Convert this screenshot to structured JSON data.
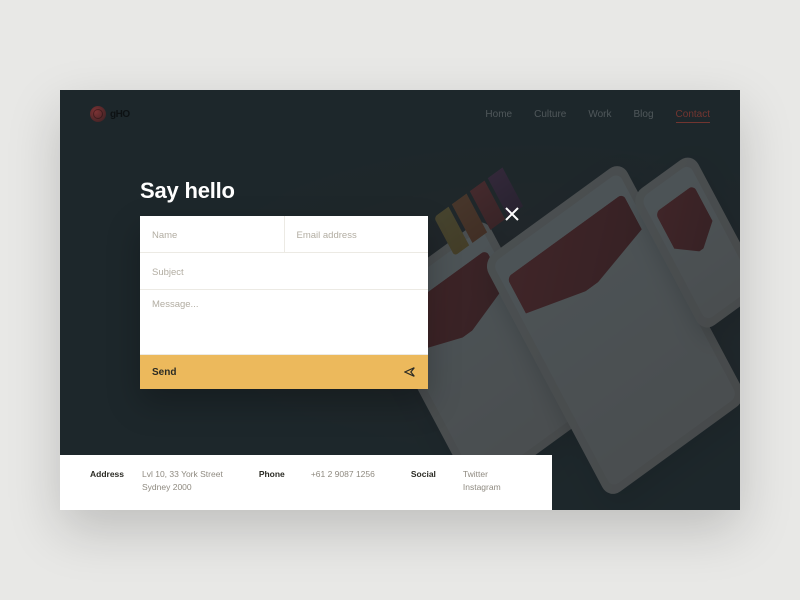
{
  "brand": {
    "name": "gHO"
  },
  "nav": {
    "items": [
      {
        "label": "Home"
      },
      {
        "label": "Culture"
      },
      {
        "label": "Work"
      },
      {
        "label": "Blog"
      },
      {
        "label": "Contact"
      }
    ]
  },
  "heading": "Say hello",
  "form": {
    "name_placeholder": "Name",
    "email_placeholder": "Email address",
    "subject_placeholder": "Subject",
    "message_placeholder": "Message...",
    "send_label": "Send"
  },
  "footer": {
    "address_label": "Address",
    "address_line1": "Lvl 10, 33 York Street",
    "address_line2": "Sydney 2000",
    "phone_label": "Phone",
    "phone_value": "+61 2 9087 1256",
    "social_label": "Social",
    "social_twitter": "Twitter",
    "social_instagram": "Instagram"
  }
}
